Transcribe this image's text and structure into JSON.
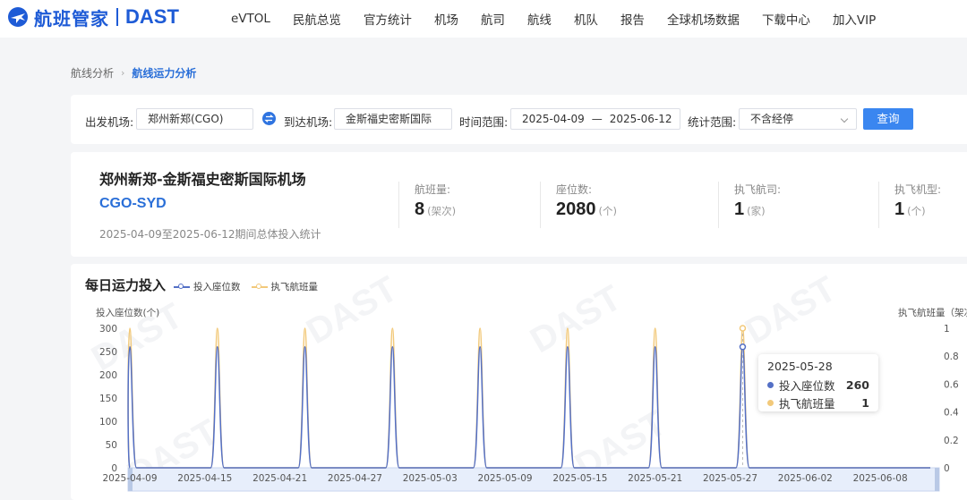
{
  "header": {
    "logo_cn": "航班管家",
    "logo_en": "DAST",
    "nav": [
      "eVTOL",
      "民航总览",
      "官方统计",
      "机场",
      "航司",
      "航线",
      "机队",
      "报告",
      "全球机场数据",
      "下载中心",
      "加入VIP"
    ]
  },
  "breadcrumb": {
    "parent": "航线分析",
    "current": "航线运力分析"
  },
  "filter": {
    "dep_label": "出发机场:",
    "dep_value": "郑州新郑(CGO)",
    "arr_label": "到达机场:",
    "arr_value": "金斯福史密斯国际",
    "time_label": "时间范围:",
    "start_date": "2025-04-09",
    "range_sep": "—",
    "end_date": "2025-06-12",
    "scope_label": "统计范围:",
    "scope_value": "不含经停",
    "query_label": "查询"
  },
  "summary": {
    "route_name": "郑州新郑-金斯福史密斯国际机场",
    "route_code": "CGO-SYD",
    "period": "2025-04-09至2025-06-12期间总体投入统计",
    "stats": [
      {
        "label": "航班量:",
        "value": "8",
        "unit": "(架次)"
      },
      {
        "label": "座位数:",
        "value": "2080",
        "unit": "(个)"
      },
      {
        "label": "执飞航司:",
        "value": "1",
        "unit": "(家)"
      },
      {
        "label": "执飞机型:",
        "value": "1",
        "unit": "(个)"
      }
    ]
  },
  "chart_section": {
    "title": "每日运力投入",
    "tooltip": {
      "date": "2025-05-28",
      "row1_label": "投入座位数",
      "row1_value": "260",
      "row2_label": "执飞航班量",
      "row2_value": "1"
    },
    "watermark_text": "DAST"
  },
  "colors": {
    "accent": "#2a6fd8",
    "seats_series": "#5470c6",
    "flights_series": "#f2c97a",
    "button": "#3a86f0"
  },
  "chart_data": {
    "type": "line",
    "ylabel": "投入座位数(个)",
    "ylabel_right": "执飞航班量（架次）",
    "ylim": [
      0,
      300
    ],
    "ylim_right": [
      0,
      1
    ],
    "y_ticks": [
      "0",
      "50",
      "100",
      "150",
      "200",
      "250",
      "300"
    ],
    "y_ticks_right": [
      "0",
      "0.2",
      "0.4",
      "0.6",
      "0.8",
      "1"
    ],
    "x_tick_labels": [
      "2025-04-09",
      "2025-04-15",
      "2025-04-21",
      "2025-04-27",
      "2025-05-03",
      "2025-05-09",
      "2025-05-15",
      "2025-05-21",
      "2025-05-27",
      "2025-06-02",
      "2025-06-08"
    ],
    "series": [
      {
        "name": "投入座位数",
        "axis": "left",
        "peak_dates": [
          "2025-04-09",
          "2025-04-16",
          "2025-04-23",
          "2025-04-30",
          "2025-05-07",
          "2025-05-14",
          "2025-05-21",
          "2025-05-28"
        ],
        "peak_value": 260
      },
      {
        "name": "执飞航班量",
        "axis": "right",
        "peak_dates": [
          "2025-04-09",
          "2025-04-16",
          "2025-04-23",
          "2025-04-30",
          "2025-05-07",
          "2025-05-14",
          "2025-05-21",
          "2025-05-28"
        ],
        "peak_value": 1
      }
    ],
    "legend_position": "top-left",
    "grid": false
  }
}
